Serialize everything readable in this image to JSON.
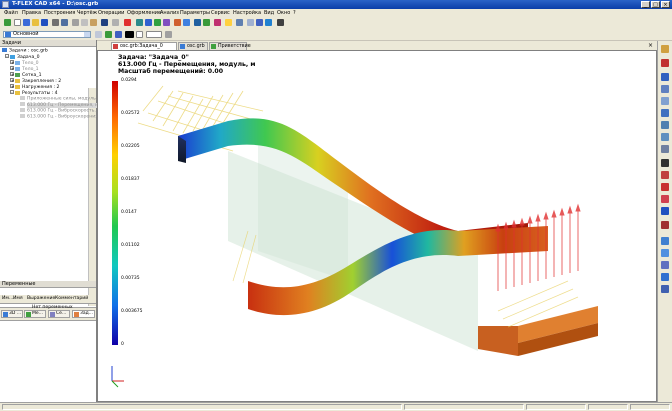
{
  "window": {
    "title": "T-FLEX CAD x64 - D:\\osc.grb"
  },
  "menu": [
    "Файл",
    "Правка",
    "Построения",
    "Чертёж",
    "Операции",
    "Оформление",
    "Анализ",
    "Параметры",
    "Сервис",
    "Настройка",
    "Вид",
    "Окно",
    "?"
  ],
  "toolbar2": {
    "layer_value": "Основной"
  },
  "tasks_panel": {
    "title": "Задачи",
    "root": "Задачи : osc.grb",
    "task": "Задача_0",
    "items": [
      "Тело_0",
      "Тело_1",
      "Сетка_1",
      "Закрепления : 2",
      "Нагружения : 2",
      "Результаты : 4"
    ],
    "results": [
      "Приложенные силы, модуль, Н",
      "613.000 Гц - Перемещения, м...",
      "613.000 Гц - Виброскорость...",
      "613.000 Гц - Виброускорения, ..."
    ]
  },
  "panel_tabs": [
    "3D ...",
    "Ме...",
    "Се...",
    "Зад..."
  ],
  "variables_panel": {
    "title": "Переменные",
    "columns": [
      "Им...",
      "Имя",
      "Выражение",
      "Комментарий"
    ],
    "empty_text": "Нет переменных"
  },
  "document_tabs": [
    "osc.grb:Задача_0",
    "osc.grb",
    "Приветствие"
  ],
  "viewport": {
    "line1": "Задача: \"Задача_0\"",
    "line2": "613.000 Гц - Перемещения, модуль, м",
    "line3": "Масштаб перемещений: 0.00"
  },
  "chart_data": {
    "type": "heatmap",
    "legend_ticks": [
      "0.0294",
      "0.02572",
      "0.02205",
      "0.01837",
      "0.0147",
      "0.01102",
      "0.00735",
      "0.003675",
      "0"
    ],
    "colors": {
      "max": "#d00000",
      "mid": "#20c850",
      "min": "#1000a8"
    }
  }
}
